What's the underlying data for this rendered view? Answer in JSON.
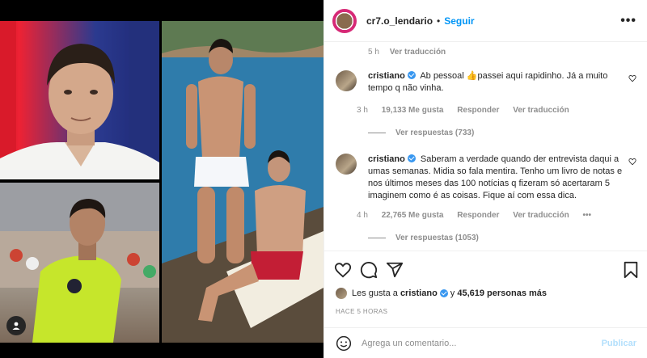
{
  "post": {
    "username": "cr7.o_lendario",
    "follow_label": "Seguir",
    "more_label": "•••"
  },
  "previous_comment_meta": {
    "time": "5 h",
    "translate": "Ver traducción"
  },
  "comments": [
    {
      "username": "cristiano",
      "text_before": "Ab pessoal",
      "emoji": "👍",
      "text_after": "passei aqui rapidinho. Já a muito tempo q não vinha.",
      "time": "3 h",
      "likes": "19,133 Me gusta",
      "reply": "Responder",
      "translate": "Ver traducción",
      "replies": "Ver respuestas (733)"
    },
    {
      "username": "cristiano",
      "text": "Saberam a verdade quando der entrevista daqui a umas semanas. Midia so fala mentira. Tenho um livro de notas e nos últimos meses das 100 notícias q fizeram só acertaram 5 imaginem como é as coisas. Fique aí com essa dica.",
      "time": "4 h",
      "likes": "22,765 Me gusta",
      "reply": "Responder",
      "translate": "Ver traducción",
      "more": "•••",
      "replies": "Ver respuestas (1053)"
    }
  ],
  "likes_summary": {
    "prefix": "Les gusta a",
    "user": "cristiano",
    "connector": "y",
    "count": "45,619 personas más"
  },
  "time_ago": "HACE 5 HORAS",
  "composer": {
    "placeholder": "Agrega un comentario...",
    "publish_label": "Publicar"
  },
  "icons": [
    "heart-icon",
    "comment-icon",
    "share-icon",
    "bookmark-icon",
    "emoji-icon",
    "verified-icon",
    "expand-icon",
    "more-icon"
  ],
  "colors": {
    "link_blue": "#0095f6",
    "verified_blue": "#3897f0",
    "muted": "#8e8e8e",
    "publish_disabled": "#b2dffc"
  }
}
